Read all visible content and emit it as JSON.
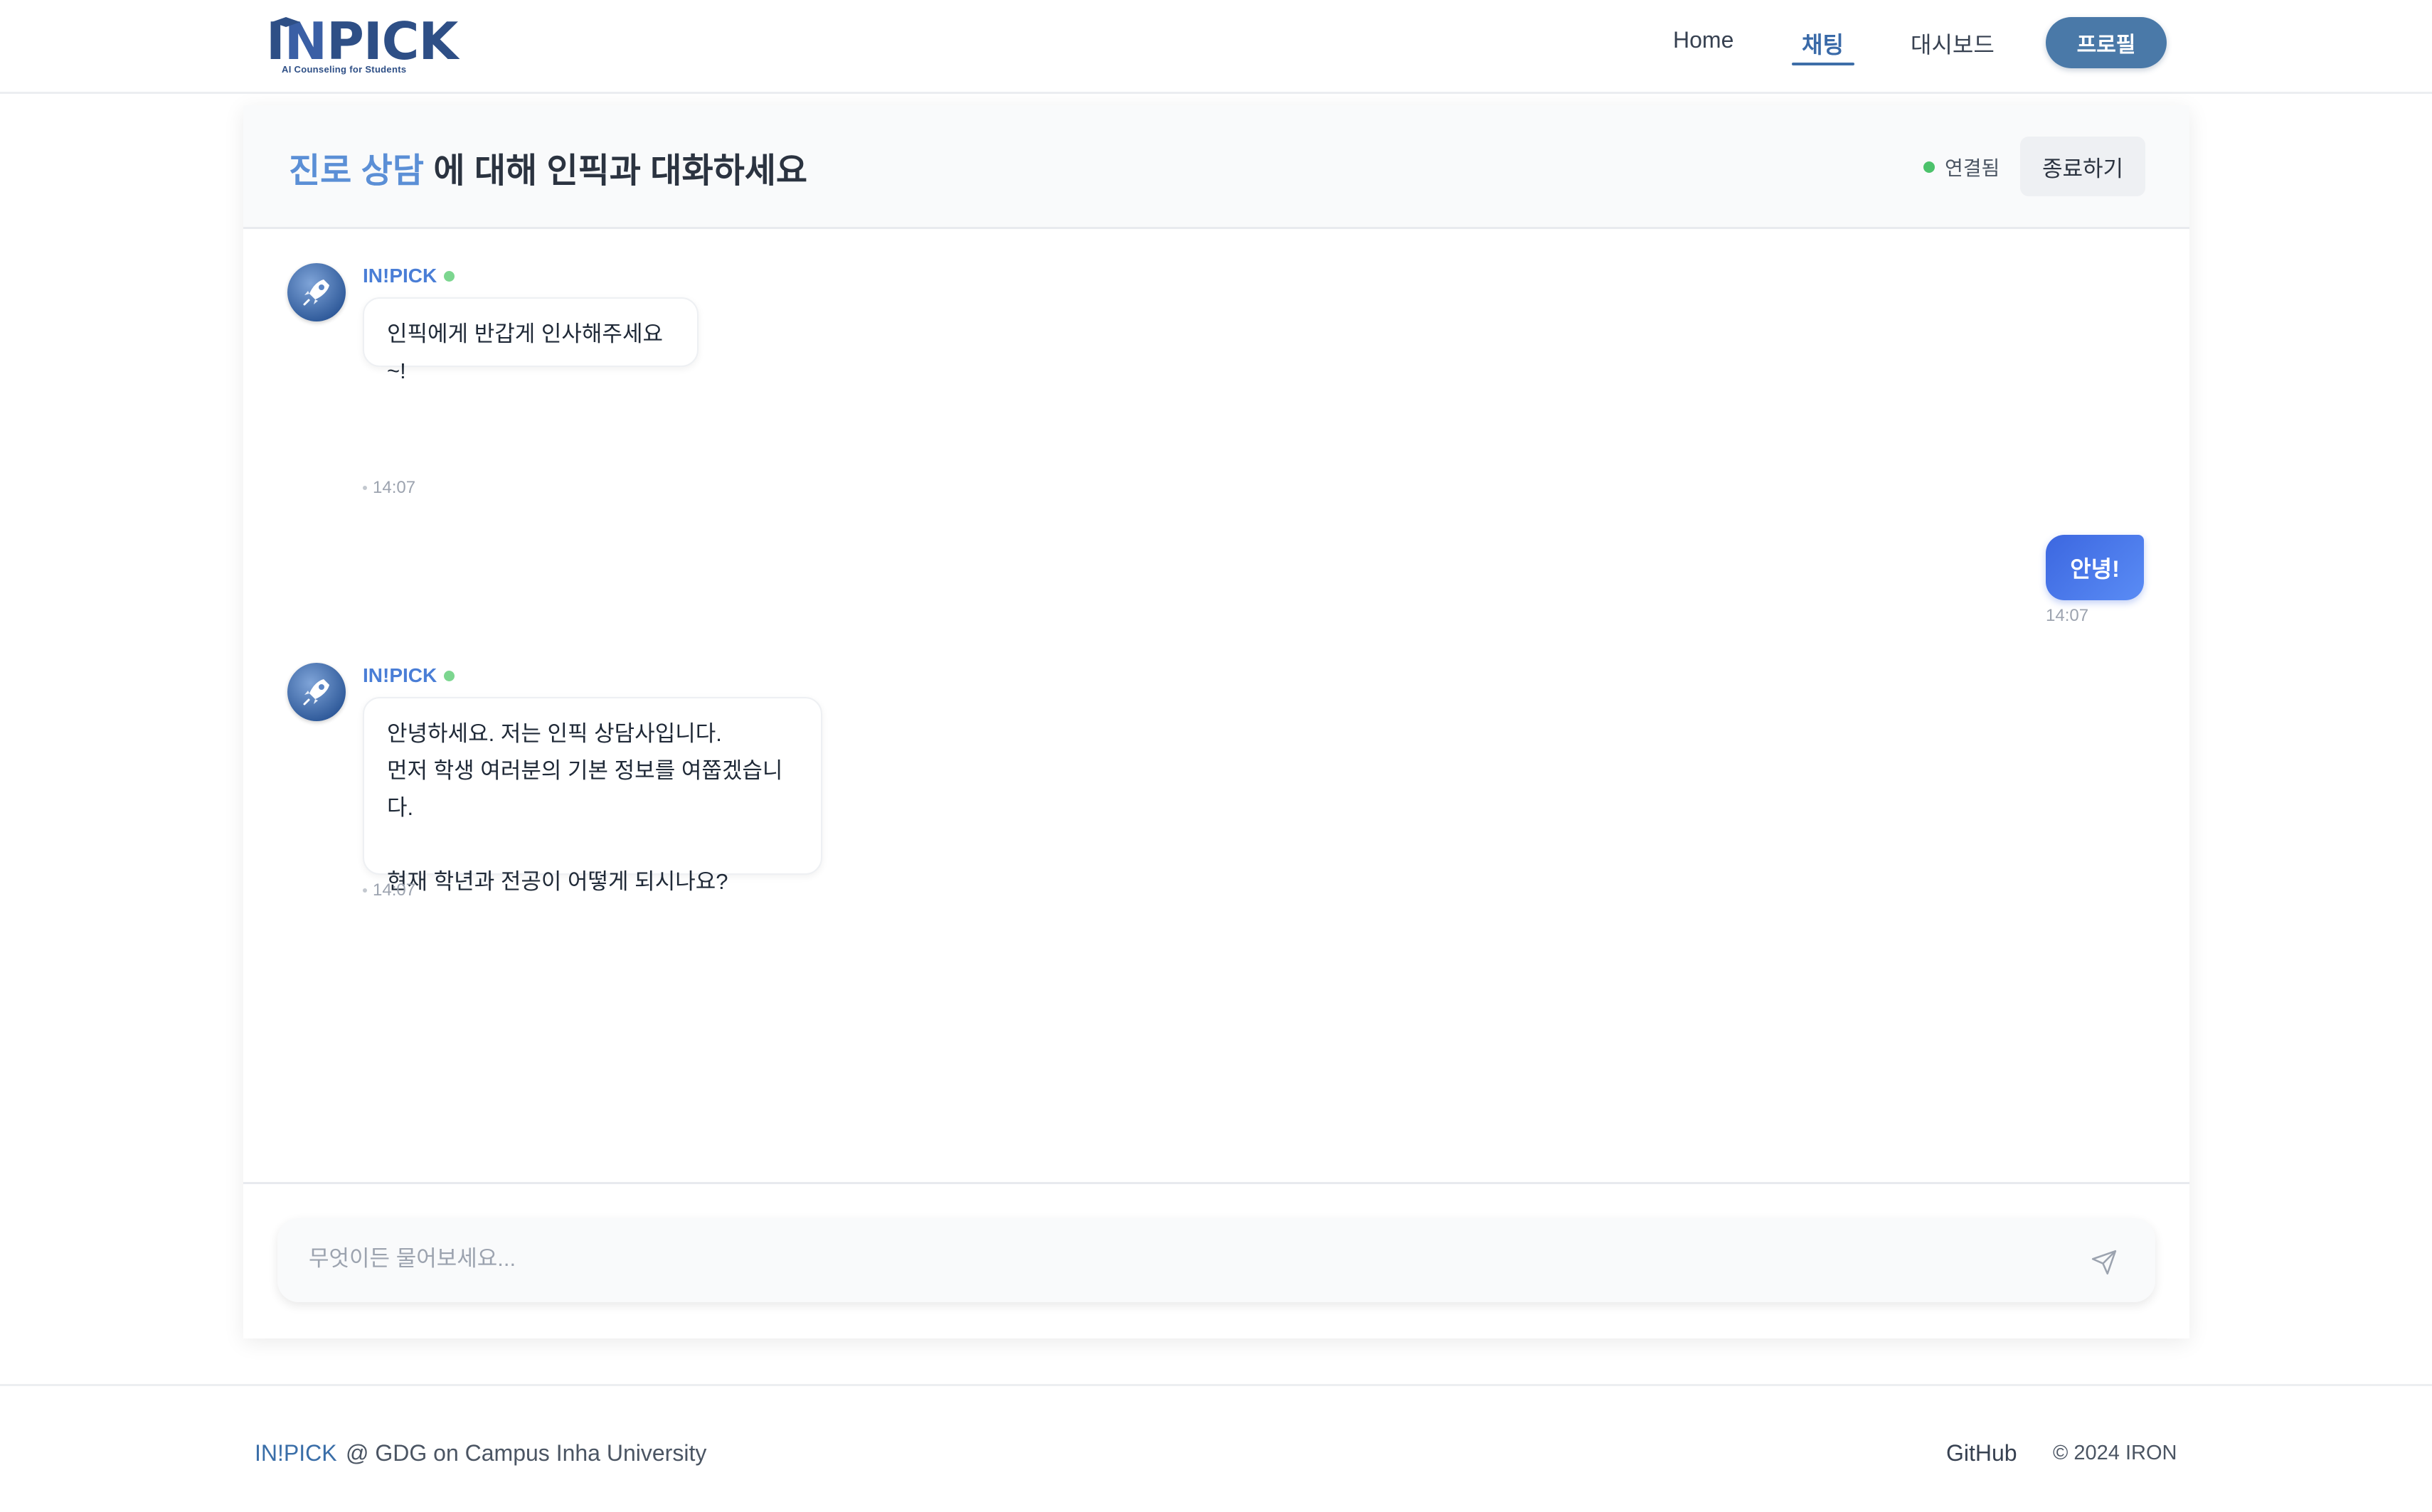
{
  "header": {
    "logo": {
      "word_a": "I",
      "word_b": "N",
      "word_c": "PICK",
      "tagline": "AI Counseling for Students"
    },
    "nav": {
      "home": "Home",
      "chat": "채팅",
      "dashboard": "대시보드",
      "active": "chat"
    },
    "profile_label": "프로필",
    "colors": {
      "brand": "#2e4f86",
      "accent": "#3d6ea8"
    }
  },
  "chat": {
    "title": {
      "topic": "진로 상담",
      "suffix": " 에 대해 인픽과 대화하세요"
    },
    "status": "연결됨",
    "end_label": "종료하기",
    "messages": [
      {
        "sender": "bot",
        "name": "IN!PICK",
        "text": "인픽에게 반갑게 인사해주세요~!",
        "time": "14:07"
      },
      {
        "sender": "user",
        "text": "안녕!",
        "time": "14:07"
      },
      {
        "sender": "bot",
        "name": "IN!PICK",
        "text": "안녕하세요. 저는 인픽 상담사입니다.\n먼저 학생 여러분의 기본 정보를 여쭙겠습니다.\n\n현재 학년과 전공이 어떻게 되시나요?",
        "time": "14:07"
      }
    ],
    "composer": {
      "placeholder": "무엇이든 물어보세요...",
      "value": "",
      "send_icon": "send-icon"
    },
    "colors": {
      "user_bubble": "#3c67e0",
      "online": "#4cc26b"
    }
  },
  "footer": {
    "brand": "IN!PICK",
    "tagline": "@ GDG on Campus Inha University",
    "github": "GitHub",
    "copyright": "© 2024 IRON"
  }
}
